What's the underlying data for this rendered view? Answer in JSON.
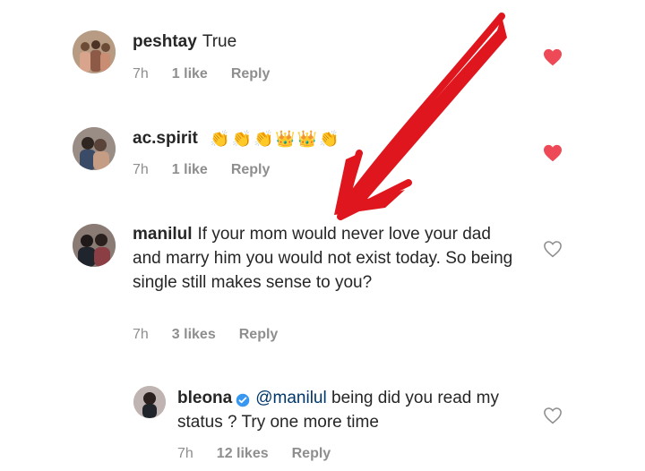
{
  "comments": [
    {
      "username": "peshtay",
      "text": "True",
      "time": "7h",
      "likes": "1 like",
      "reply": "Reply",
      "liked": true
    },
    {
      "username": "ac.spirit",
      "text": "",
      "emojis": [
        "👏",
        "👏",
        "👏",
        "👑",
        "👑",
        "👏"
      ],
      "time": "7h",
      "likes": "1 like",
      "reply": "Reply",
      "liked": true
    },
    {
      "username": "manilul",
      "text": "If your mom would never love your dad and marry him you would not exist today. So being single still makes sense to you?",
      "time": "7h",
      "likes": "3 likes",
      "reply": "Reply",
      "liked": false
    }
  ],
  "reply": {
    "username": "bleona",
    "verified": true,
    "mention": "@manilul",
    "text": "being did you read my status ? Try one more time",
    "time": "7h",
    "likes": "12 likes",
    "reply": "Reply",
    "liked": false
  },
  "colors": {
    "text": "#262626",
    "muted": "#8e8e8e",
    "liked_heart": "#ed4956",
    "unliked_heart": "#8e8e8e",
    "mention": "#00376b",
    "verified": "#3897f0",
    "annotation_arrow": "#e0161e"
  }
}
